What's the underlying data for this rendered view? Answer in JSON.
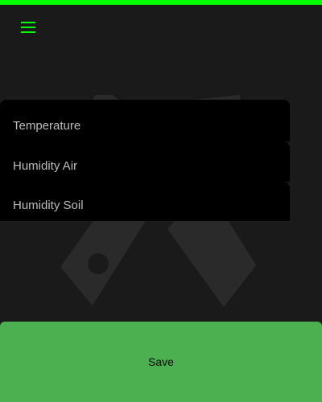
{
  "colors": {
    "accent": "#00ff00",
    "background": "#1a1a1a",
    "menu_background": "#000000",
    "menu_text": "#bdbdbd",
    "save_button": "#4caf50",
    "art": "#2a2a2a"
  },
  "header": {
    "menu_icon": "hamburger-menu-icon"
  },
  "background_art": {
    "icon": "crossed-tools-icon"
  },
  "menu": {
    "items": [
      {
        "label": "Temperature"
      },
      {
        "label": "Humidity Air"
      },
      {
        "label": "Humidity Soil"
      }
    ]
  },
  "footer": {
    "save_label": "Save"
  }
}
